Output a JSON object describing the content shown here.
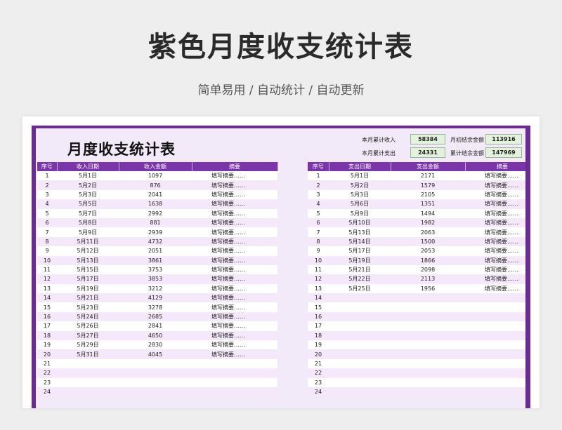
{
  "header": {
    "title": "紫色月度收支统计表",
    "subtitle": "简单易用 / 自动统计 / 自动更新"
  },
  "sheet": {
    "title": "月度收支统计表",
    "summary": {
      "income_total_label": "本月累计收入",
      "income_total_value": "58384",
      "expense_total_label": "本月累计支出",
      "expense_total_value": "24331",
      "opening_balance_label": "月初结余金额",
      "opening_balance_value": "113916",
      "closing_balance_label": "累计结余金额",
      "closing_balance_value": "147969"
    },
    "income_table": {
      "headers": [
        "序号",
        "收入日期",
        "收入金额",
        "摘要"
      ],
      "rows": [
        [
          "1",
          "5月1日",
          "1097",
          "填写摘要……"
        ],
        [
          "2",
          "5月2日",
          "876",
          "填写摘要……"
        ],
        [
          "3",
          "5月3日",
          "2041",
          "填写摘要……"
        ],
        [
          "4",
          "5月5日",
          "1638",
          "填写摘要……"
        ],
        [
          "5",
          "5月7日",
          "2992",
          "填写摘要……"
        ],
        [
          "6",
          "5月8日",
          "881",
          "填写摘要……"
        ],
        [
          "7",
          "5月9日",
          "2939",
          "填写摘要……"
        ],
        [
          "8",
          "5月11日",
          "4732",
          "填写摘要……"
        ],
        [
          "9",
          "5月12日",
          "2051",
          "填写摘要……"
        ],
        [
          "10",
          "5月13日",
          "3861",
          "填写摘要……"
        ],
        [
          "11",
          "5月15日",
          "3753",
          "填写摘要……"
        ],
        [
          "12",
          "5月17日",
          "3853",
          "填写摘要……"
        ],
        [
          "13",
          "5月19日",
          "3212",
          "填写摘要……"
        ],
        [
          "14",
          "5月21日",
          "4129",
          "填写摘要……"
        ],
        [
          "15",
          "5月23日",
          "3278",
          "填写摘要……"
        ],
        [
          "16",
          "5月24日",
          "2685",
          "填写摘要……"
        ],
        [
          "17",
          "5月26日",
          "2841",
          "填写摘要……"
        ],
        [
          "18",
          "5月27日",
          "4650",
          "填写摘要……"
        ],
        [
          "19",
          "5月29日",
          "2830",
          "填写摘要……"
        ],
        [
          "20",
          "5月31日",
          "4045",
          "填写摘要……"
        ],
        [
          "21",
          "",
          "",
          ""
        ],
        [
          "22",
          "",
          "",
          ""
        ],
        [
          "23",
          "",
          "",
          ""
        ],
        [
          "24",
          "",
          "",
          ""
        ]
      ]
    },
    "expense_table": {
      "headers": [
        "序号",
        "支出日期",
        "支出金额",
        "摘要"
      ],
      "rows": [
        [
          "1",
          "5月1日",
          "2171",
          "填写摘要……"
        ],
        [
          "2",
          "5月2日",
          "1579",
          "填写摘要……"
        ],
        [
          "3",
          "5月3日",
          "2105",
          "填写摘要……"
        ],
        [
          "4",
          "5月6日",
          "1351",
          "填写摘要……"
        ],
        [
          "5",
          "5月9日",
          "1494",
          "填写摘要……"
        ],
        [
          "6",
          "5月10日",
          "1982",
          "填写摘要……"
        ],
        [
          "7",
          "5月13日",
          "2063",
          "填写摘要……"
        ],
        [
          "8",
          "5月14日",
          "1500",
          "填写摘要……"
        ],
        [
          "9",
          "5月17日",
          "2053",
          "填写摘要……"
        ],
        [
          "10",
          "5月19日",
          "1866",
          "填写摘要……"
        ],
        [
          "11",
          "5月21日",
          "2098",
          "填写摘要……"
        ],
        [
          "12",
          "5月22日",
          "2113",
          "填写摘要……"
        ],
        [
          "13",
          "5月25日",
          "1956",
          "填写摘要……"
        ],
        [
          "14",
          "",
          "",
          ""
        ],
        [
          "15",
          "",
          "",
          ""
        ],
        [
          "16",
          "",
          "",
          ""
        ],
        [
          "17",
          "",
          "",
          ""
        ],
        [
          "18",
          "",
          "",
          ""
        ],
        [
          "19",
          "",
          "",
          ""
        ],
        [
          "20",
          "",
          "",
          ""
        ],
        [
          "21",
          "",
          "",
          ""
        ],
        [
          "22",
          "",
          "",
          ""
        ],
        [
          "23",
          "",
          "",
          ""
        ],
        [
          "24",
          "",
          "",
          ""
        ]
      ]
    }
  },
  "colors": {
    "frame": "#6b2a94",
    "header_row": "#7a35a8",
    "row_alt": "#f4e8fa",
    "summary_box": "#e3f2dc"
  }
}
